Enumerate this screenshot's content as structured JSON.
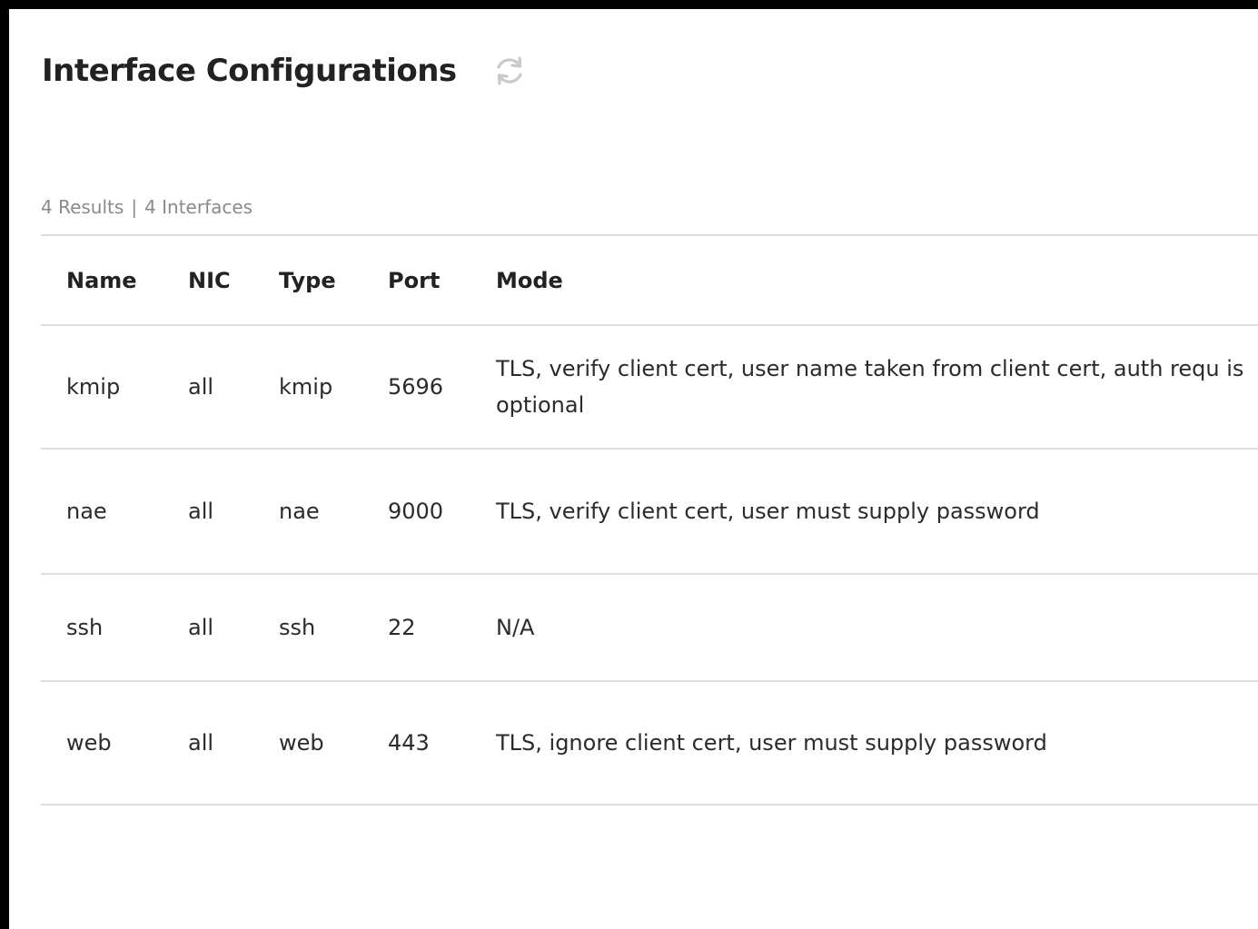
{
  "header": {
    "title": "Interface Configurations",
    "refresh_icon": "refresh-icon"
  },
  "summary": {
    "results": "4 Results",
    "separator": "|",
    "interfaces": "4 Interfaces"
  },
  "table": {
    "columns": [
      "Name",
      "NIC",
      "Type",
      "Port",
      "Mode"
    ],
    "rows": [
      {
        "name": "kmip",
        "nic": "all",
        "type": "kmip",
        "port": "5696",
        "mode": "TLS, verify client cert, user name taken from client cert, auth requ is optional"
      },
      {
        "name": "nae",
        "nic": "all",
        "type": "nae",
        "port": "9000",
        "mode": "TLS, verify client cert, user must supply password"
      },
      {
        "name": "ssh",
        "nic": "all",
        "type": "ssh",
        "port": "22",
        "mode": "N/A"
      },
      {
        "name": "web",
        "nic": "all",
        "type": "web",
        "port": "443",
        "mode": "TLS, ignore client cert, user must supply password"
      }
    ]
  },
  "colors": {
    "border": "#000000",
    "divider": "#dddddd",
    "text": "#2b2b2b",
    "muted": "#8a8a8a"
  }
}
